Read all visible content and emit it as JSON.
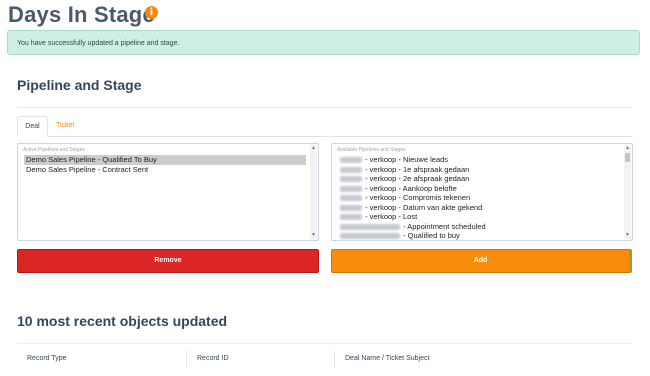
{
  "page": {
    "title": "Days In Stage",
    "info_icon": "i"
  },
  "alert": {
    "message": "You have successfully updated a pipeline and stage."
  },
  "section": {
    "title": "Pipeline and Stage"
  },
  "tabs": [
    {
      "label": "Deal",
      "active": true
    },
    {
      "label": "Ticket",
      "active": false
    }
  ],
  "active_list": {
    "label": "Active Pipelines and Stages",
    "items": [
      {
        "text": "Demo Sales Pipeline - Qualified To Buy",
        "selected": true
      },
      {
        "text": "Demo Sales Pipeline - Contract Sent",
        "selected": false
      }
    ]
  },
  "available_list": {
    "label": "Available Pipelines and Stages",
    "items": [
      {
        "text": " - verkoop - Nieuwe leads"
      },
      {
        "text": " - verkoop - 1e afspraak gedaan"
      },
      {
        "text": " - verkoop - 2e afspraak gedaan"
      },
      {
        "text": " - verkoop - Aankoop belofte"
      },
      {
        "text": " - verkoop - Compromis tekenen"
      },
      {
        "text": " - verkoop - Datum van akte gekend"
      },
      {
        "text": " - verkoop - Lost"
      },
      {
        "text": " - Appointment scheduled"
      },
      {
        "text": " - Qualified to buy"
      }
    ]
  },
  "buttons": {
    "remove": "Remove",
    "add": "Add"
  },
  "recent": {
    "title": "10 most recent objects updated",
    "columns": [
      "Record Type",
      "Record ID",
      "Deal Name / Ticket Subject"
    ]
  },
  "colors": {
    "accent": "#f5890d",
    "danger": "#dc2525",
    "success_bg": "#cfeee4"
  }
}
